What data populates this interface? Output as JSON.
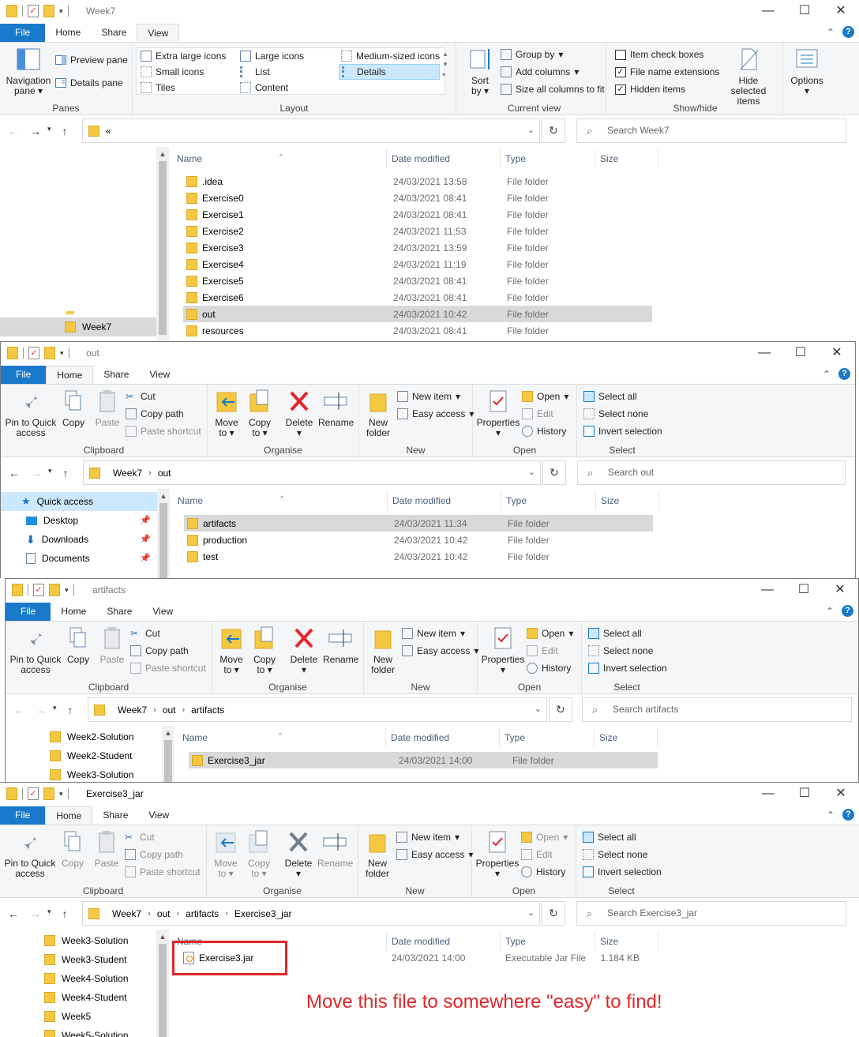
{
  "window1": {
    "title": "Week7",
    "tabs": [
      "File",
      "Home",
      "Share",
      "View"
    ],
    "ribbon": {
      "panes": {
        "nav_pane": "Navigation pane",
        "preview_pane": "Preview pane",
        "details_pane": "Details pane",
        "label": "Panes"
      },
      "layout": {
        "extra_large": "Extra large icons",
        "large": "Large icons",
        "medium": "Medium-sized icons",
        "small": "Small icons",
        "list": "List",
        "details": "Details",
        "tiles": "Tiles",
        "content": "Content",
        "label": "Layout"
      },
      "current_view": {
        "sort": "Sort by",
        "group": "Group by",
        "add_columns": "Add columns",
        "size_columns": "Size all columns to fit",
        "label": "Current view"
      },
      "show_hide": {
        "item_check": "Item check boxes",
        "extensions": "File name extensions",
        "hidden": "Hidden items",
        "hide_selected": "Hide selected items",
        "label": "Show/hide"
      },
      "options": "Options"
    },
    "address": {
      "text": "«"
    },
    "search_placeholder": "Search Week7",
    "nav": [
      {
        "label": "Week7"
      }
    ],
    "columns": [
      "Name",
      "Date modified",
      "Type",
      "Size"
    ],
    "rows": [
      {
        "name": ".idea",
        "date": "24/03/2021 13:58",
        "type": "File folder"
      },
      {
        "name": "Exercise0",
        "date": "24/03/2021 08:41",
        "type": "File folder"
      },
      {
        "name": "Exercise1",
        "date": "24/03/2021 08:41",
        "type": "File folder"
      },
      {
        "name": "Exercise2",
        "date": "24/03/2021 11:53",
        "type": "File folder"
      },
      {
        "name": "Exercise3",
        "date": "24/03/2021 13:59",
        "type": "File folder"
      },
      {
        "name": "Exercise4",
        "date": "24/03/2021 11:19",
        "type": "File folder"
      },
      {
        "name": "Exercise5",
        "date": "24/03/2021 08:41",
        "type": "File folder"
      },
      {
        "name": "Exercise6",
        "date": "24/03/2021 08:41",
        "type": "File folder"
      },
      {
        "name": "out",
        "date": "24/03/2021 10:42",
        "type": "File folder"
      },
      {
        "name": "resources",
        "date": "24/03/2021 08:41",
        "type": "File folder"
      }
    ]
  },
  "home_ribbon": {
    "pin": "Pin to Quick access",
    "copy": "Copy",
    "paste": "Paste",
    "cut": "Cut",
    "copy_path": "Copy path",
    "paste_shortcut": "Paste shortcut",
    "clipboard": "Clipboard",
    "move_to": "Move to",
    "copy_to": "Copy to",
    "delete": "Delete",
    "rename": "Rename",
    "organise": "Organise",
    "new_folder": "New folder",
    "new_item": "New item",
    "easy_access": "Easy access",
    "new": "New",
    "properties": "Properties",
    "open": "Open",
    "edit": "Edit",
    "history": "History",
    "open_label": "Open",
    "select_all": "Select all",
    "select_none": "Select none",
    "invert": "Invert selection",
    "select": "Select"
  },
  "window2": {
    "title": "out",
    "tabs": [
      "File",
      "Home",
      "Share",
      "View"
    ],
    "breadcrumbs": [
      "Week7",
      "out"
    ],
    "search_placeholder": "Search out",
    "nav": [
      "Quick access",
      "Desktop",
      "Downloads",
      "Documents"
    ],
    "columns": [
      "Name",
      "Date modified",
      "Type",
      "Size"
    ],
    "rows": [
      {
        "name": "artifacts",
        "date": "24/03/2021 11:34",
        "type": "File folder"
      },
      {
        "name": "production",
        "date": "24/03/2021 10:42",
        "type": "File folder"
      },
      {
        "name": "test",
        "date": "24/03/2021 10:42",
        "type": "File folder"
      }
    ]
  },
  "window3": {
    "title": "artifacts",
    "tabs": [
      "File",
      "Home",
      "Share",
      "View"
    ],
    "breadcrumbs": [
      "Week7",
      "out",
      "artifacts"
    ],
    "search_placeholder": "Search artifacts",
    "nav": [
      "Week2-Solution",
      "Week2-Student",
      "Week3-Solution"
    ],
    "columns": [
      "Name",
      "Date modified",
      "Type",
      "Size"
    ],
    "rows": [
      {
        "name": "Exercise3_jar",
        "date": "24/03/2021 14:00",
        "type": "File folder"
      }
    ]
  },
  "window4": {
    "title": "Exercise3_jar",
    "tabs": [
      "File",
      "Home",
      "Share",
      "View"
    ],
    "breadcrumbs": [
      "Week7",
      "out",
      "artifacts",
      "Exercise3_jar"
    ],
    "search_placeholder": "Search Exercise3_jar",
    "nav": [
      "Week3-Solution",
      "Week3-Student",
      "Week4-Solution",
      "Week4-Student",
      "Week5",
      "Week5-Solution"
    ],
    "columns": [
      "Name",
      "Date modified",
      "Type",
      "Size"
    ],
    "rows": [
      {
        "name": "Exercise3.jar",
        "date": "24/03/2021 14:00",
        "type": "Executable Jar File",
        "size": "1.184 KB"
      }
    ],
    "annotation": "Move this file to somewhere \"easy\" to find!"
  },
  "colors": {
    "accent": "#1979ca",
    "folder": "#f5c842",
    "annotation": "#e3262b",
    "selection": "#d9d9d9"
  }
}
